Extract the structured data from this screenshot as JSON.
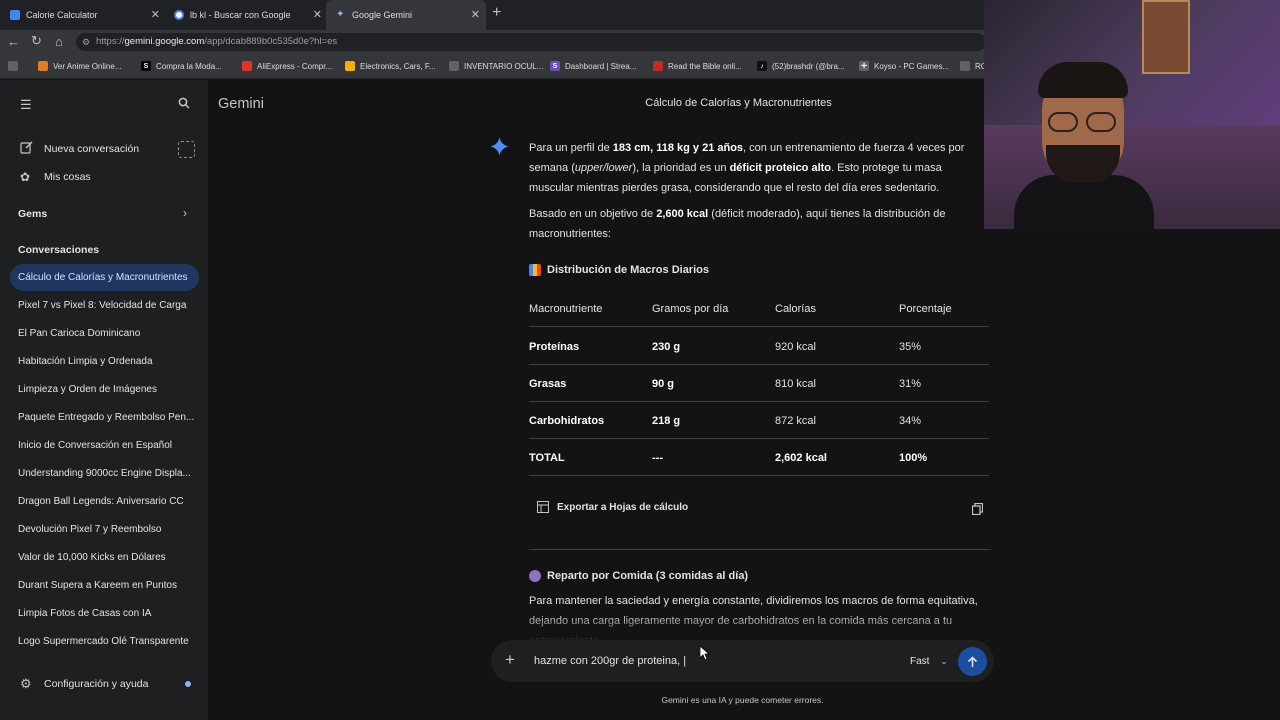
{
  "browser": {
    "tabs": [
      {
        "title": "Calorie Calculator",
        "color": "#4285f4"
      },
      {
        "title": "lb kl - Buscar con Google",
        "color": "#34a853"
      },
      {
        "title": "Google Gemini",
        "color": "#8ab4f8"
      }
    ],
    "url_prefix": "https://",
    "url_host": "gemini.google.com",
    "url_path": "/app/dcab889b0c535d0e?hl=es",
    "bookmarks": [
      {
        "label": "Ver Anime Online...",
        "icon": "anime-icon",
        "color": "#e67c22"
      },
      {
        "label": "Compra la Moda...",
        "icon": "S",
        "color": "#000000"
      },
      {
        "label": "AliExpress - Compr...",
        "icon": "aliexpress-icon",
        "color": "#e43225"
      },
      {
        "label": "Electronics, Cars, F...",
        "icon": "ebay-icon",
        "color": "#f5af02"
      },
      {
        "label": "INVENTARIO OCUL...",
        "icon": "inventory-icon",
        "color": "#5f6368"
      },
      {
        "label": "Dashboard | Strea...",
        "icon": "SL",
        "color": "#6b4fbb"
      },
      {
        "label": "Read the Bible onli...",
        "icon": "bible-icon",
        "color": "#c62828"
      },
      {
        "label": "(52)brashdr (@bra...",
        "icon": "tiktok-icon",
        "color": "#111111"
      },
      {
        "label": "Koyso - PC Games...",
        "icon": "koyso-icon",
        "color": "#5f6368"
      },
      {
        "label": "RC",
        "icon": "rc-icon",
        "color": "#5f6368"
      }
    ]
  },
  "sidebar": {
    "new_chat": "Nueva conversación",
    "my_stuff": "Mis cosas",
    "gems": "Gems",
    "conversations_header": "Conversaciones",
    "items": [
      "Cálculo de Calorías y Macronutrientes",
      "Pixel 7 vs Pixel 8: Velocidad de Carga",
      "El Pan Carioca Dominicano",
      "Habitación Limpia y Ordenada",
      "Limpieza y Orden de Imágenes",
      "Paquete Entregado y Reembolso Pen...",
      "Inicio de Conversación en Español",
      "Understanding 9000cc Engine Displa...",
      "Dragon Ball Legends: Aniversario CC",
      "Devolución Pixel 7 y Reembolso",
      "Valor de 10,000 Kicks en Dólares",
      "Durant Supera a Kareem en Puntos",
      "Limpia Fotos de Casas con IA",
      "Logo Supermercado Olé Transparente"
    ],
    "settings": "Configuración y ayuda"
  },
  "main": {
    "app_title": "Gemini",
    "conversation_title": "Cálculo de Calorías y Macronutrientes",
    "p1": {
      "a": "Para un perfil de ",
      "b": "183 cm, 118 kg y 21 años",
      "c": ", con un entrenamiento de fuerza 4 veces por semana (",
      "d": "upper/lower",
      "e": "), la prioridad es un ",
      "f": "déficit proteico alto",
      "g": ". Esto protege tu masa muscular mientras pierdes grasa, considerando que el resto del día eres sedentario."
    },
    "p2": {
      "a": "Basado en un objetivo de ",
      "b": "2,600 kcal",
      "c": " (déficit moderado), aquí tienes la distribución de macronutrientes:"
    },
    "section1": "Distribución de Macros Diarios",
    "table": {
      "headers": [
        "Macronutriente",
        "Gramos por día",
        "Calorías",
        "Porcentaje"
      ],
      "rows": [
        [
          "Proteínas",
          "230 g",
          "920 kcal",
          "35%"
        ],
        [
          "Grasas",
          "90 g",
          "810 kcal",
          "31%"
        ],
        [
          "Carbohidratos",
          "218 g",
          "872 kcal",
          "34%"
        ],
        [
          "TOTAL",
          "---",
          "2,602 kcal",
          "100%"
        ]
      ]
    },
    "export_label": "Exportar a Hojas de cálculo",
    "section2": "Reparto por Comida (3 comidas al día)",
    "p3": "Para mantener la saciedad y energía constante, dividiremos los macros de forma equitativa, dejando una carga ligeramente mayor de carbohidratos en la comida más cercana a tu entrenamiento.",
    "input_value": "hazme con 200gr de proteina, |",
    "model_label": "Fast",
    "disclaimer": "Gemini es una IA y puede cometer errores."
  },
  "colors": {
    "accent": "#1f3760",
    "send": "#1a4fa0",
    "gem_star": "#4c8df6"
  }
}
